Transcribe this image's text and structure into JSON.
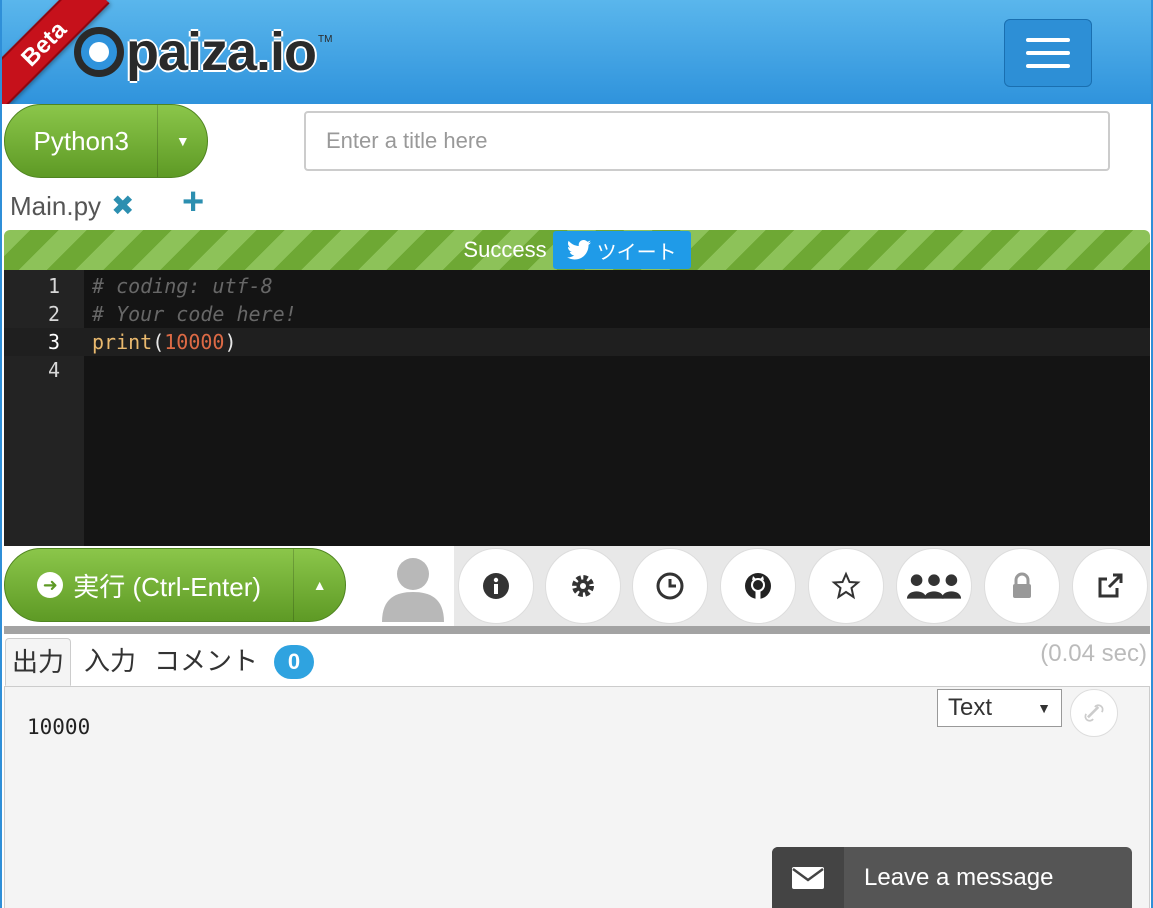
{
  "header": {
    "beta_label": "Beta",
    "logo_text": "paiza.io",
    "logo_tm": "TM",
    "menu_icon": "hamburger-menu-icon"
  },
  "language": {
    "selected": "Python3"
  },
  "title_input": {
    "placeholder": "Enter a title here",
    "value": ""
  },
  "files": [
    {
      "name": "Main.py"
    }
  ],
  "status": {
    "text": "Success",
    "tweet_label": "ツイート"
  },
  "editor": {
    "lines": [
      {
        "number": "1",
        "code": "# coding: utf-8"
      },
      {
        "number": "2",
        "code": "# Your code here!"
      },
      {
        "number": "3",
        "func": "print",
        "open": "(",
        "arg": "10000",
        "close": ")"
      },
      {
        "number": "4",
        "code": ""
      }
    ]
  },
  "run": {
    "label": "実行 (Ctrl-Enter)"
  },
  "toolbar": {
    "icons": [
      "info-icon",
      "settings-icon",
      "history-icon",
      "github-icon",
      "star-icon",
      "users-icon",
      "lock-icon",
      "share-icon"
    ]
  },
  "output_tabs": [
    {
      "label": "出力",
      "active": true
    },
    {
      "label": "入力",
      "active": false
    },
    {
      "label": "コメント",
      "active": false
    }
  ],
  "comment_count": "0",
  "exec_time": "(0.04 sec)",
  "output": {
    "text": "10000",
    "format": "Text"
  },
  "chat": {
    "label": "Leave a message"
  },
  "colors": {
    "header_blue": "#2f93dc",
    "success_green": "#6ea834",
    "run_green": "#5e9a25",
    "badge_blue": "#2fa3e0",
    "tweet_blue": "#1f9be8"
  }
}
